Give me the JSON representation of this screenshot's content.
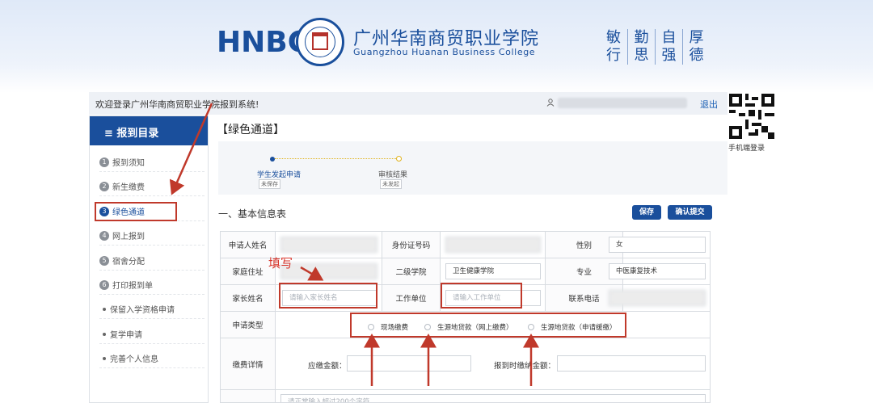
{
  "header": {
    "logo": "HNBC",
    "school_cn": "广州华南商贸职业学院",
    "school_en": "Guangzhou Huanan Business College",
    "motto": [
      {
        "top": "敏",
        "bottom": "行"
      },
      {
        "top": "勤",
        "bottom": "思"
      },
      {
        "top": "自",
        "bottom": "强"
      },
      {
        "top": "厚",
        "bottom": "德"
      }
    ]
  },
  "topbar": {
    "welcome": "欢迎登录广州华南商贸职业学院报到系统!",
    "logout": "退出"
  },
  "qr": {
    "label": "手机端登录"
  },
  "sidebar": {
    "title": "≡ 报到目录",
    "items": [
      {
        "num": "1",
        "label": "报到须知"
      },
      {
        "num": "2",
        "label": "新生缴费"
      },
      {
        "num": "3",
        "label": "绿色通道"
      },
      {
        "num": "4",
        "label": "网上报到"
      },
      {
        "num": "5",
        "label": "宿舍分配"
      },
      {
        "num": "6",
        "label": "打印报到单"
      },
      {
        "num": "",
        "label": "保留入学资格申请"
      },
      {
        "num": "",
        "label": "复学申请"
      },
      {
        "num": "",
        "label": "完善个人信息"
      }
    ]
  },
  "main": {
    "page_title": "【绿色通道】",
    "steps": [
      {
        "label": "学生发起申请",
        "status": "未保存"
      },
      {
        "label": "审核结果",
        "status": "未发起"
      }
    ],
    "section_title": "一、基本信息表",
    "save_label": "保存",
    "submit_label": "确认提交"
  },
  "form": {
    "applicant_name_label": "申请人姓名",
    "id_label": "身份证号码",
    "gender_label": "性别",
    "gender_value": "女",
    "address_label": "家庭住址",
    "college_label": "二级学院",
    "college_value": "卫生健康学院",
    "major_label": "专业",
    "major_value": "中医康复技术",
    "parent_label": "家长姓名",
    "parent_placeholder": "请输入家长姓名",
    "work_label": "工作单位",
    "work_placeholder": "请输入工作单位",
    "phone_label": "联系电话",
    "type_label": "申请类型",
    "options": [
      "现场缴费",
      "生源地贷款（网上缴费）",
      "生源地贷款（申请缓缴）"
    ],
    "fee_label": "缴费详情",
    "due_label": "应缴金额：",
    "paid_label": "报到时缴纳金额：",
    "remark_placeholder": "请正常输入超过200个字符"
  },
  "annotation": {
    "fill_note": "填写"
  },
  "colors": {
    "brand": "#1a4f9c",
    "annotation": "#c0392b",
    "link": "#1a5fb4"
  }
}
